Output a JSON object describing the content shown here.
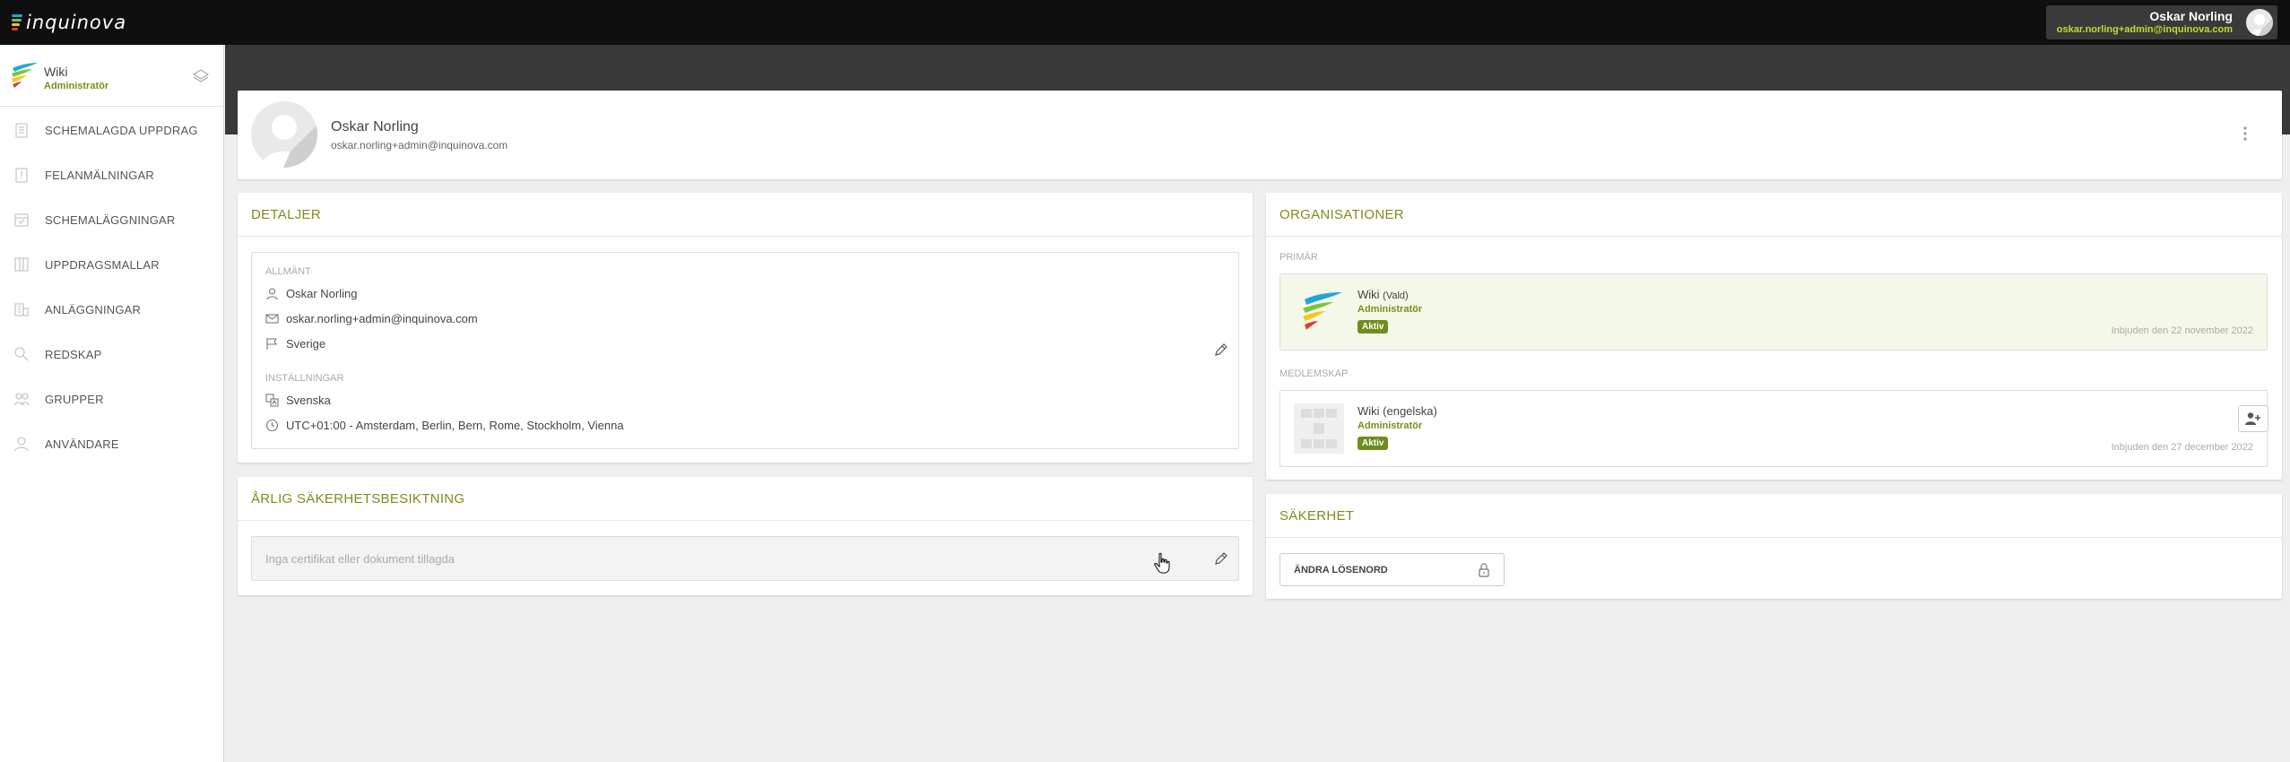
{
  "brand": {
    "name": "inquinova"
  },
  "topbar": {
    "user_name": "Oskar Norling",
    "user_email": "oskar.norling+admin@inquinova.com"
  },
  "sidebar": {
    "org_name": "Wiki",
    "org_role": "Administratör",
    "items": [
      {
        "label": "SCHEMALAGDA UPPDRAG",
        "icon": "clipboard-icon"
      },
      {
        "label": "FELANMÄLNINGAR",
        "icon": "alert-document-icon"
      },
      {
        "label": "SCHEMALÄGGNINGAR",
        "icon": "calendar-icon"
      },
      {
        "label": "UPPDRAGSMALLAR",
        "icon": "columns-icon"
      },
      {
        "label": "ANLÄGGNINGAR",
        "icon": "building-icon"
      },
      {
        "label": "REDSKAP",
        "icon": "tools-icon"
      },
      {
        "label": "GRUPPER",
        "icon": "group-icon"
      },
      {
        "label": "ANVÄNDARE",
        "icon": "user-icon"
      }
    ]
  },
  "profile": {
    "name": "Oskar Norling",
    "email": "oskar.norling+admin@inquinova.com"
  },
  "details": {
    "title": "DETALJER",
    "general_label": "ALLMÄNT",
    "name": "Oskar Norling",
    "email": "oskar.norling+admin@inquinova.com",
    "country": "Sverige",
    "settings_label": "INSTÄLLNINGAR",
    "language": "Svenska",
    "timezone": "UTC+01:00 - Amsterdam, Berlin, Bern, Rome, Stockholm, Vienna"
  },
  "certificates": {
    "title": "ÅRLIG SÄKERHETSBESIKTNING",
    "empty_text": "Inga certifikat eller dokument tillagda"
  },
  "organisations": {
    "title": "ORGANISATIONER",
    "primary_label": "PRIMÄR",
    "primary": {
      "name": "Wiki",
      "tag": "(Vald)",
      "role": "Administratör",
      "status": "Aktiv",
      "invited": "Inbjuden den 22 november 2022"
    },
    "membership_label": "MEDLEMSKAP",
    "member": {
      "name": "Wiki (engelska)",
      "role": "Administratör",
      "status": "Aktiv",
      "invited": "Inbjuden den 27 december 2022"
    }
  },
  "security": {
    "title": "SÄKERHET",
    "change_password": "ÄNDRA LÖSENORD"
  },
  "colors": {
    "accent": "#7a8d1c",
    "badge": "#6f8d1f",
    "topbar": "#0f0f0f",
    "band": "#393939"
  }
}
